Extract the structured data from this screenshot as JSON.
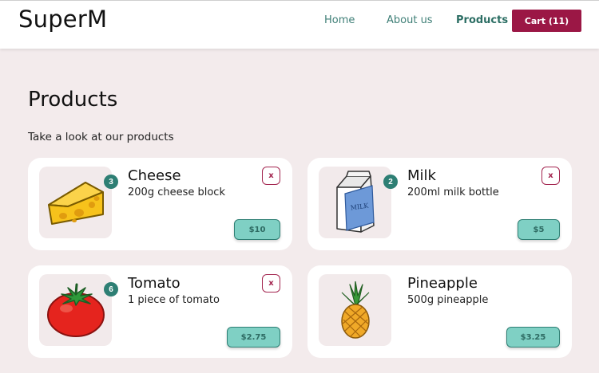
{
  "header": {
    "logo": "SuperM",
    "nav": {
      "home": "Home",
      "about": "About us",
      "products": "Products"
    },
    "cart_label": "Cart (11)"
  },
  "page": {
    "title": "Products",
    "subtitle": "Take a look at our products"
  },
  "products": [
    {
      "name": "Cheese",
      "description": "200g cheese block",
      "quantity": "3",
      "price": "$10",
      "remove_label": "x",
      "icon": "cheese-icon"
    },
    {
      "name": "Milk",
      "description": "200ml milk bottle",
      "quantity": "2",
      "price": "$5",
      "remove_label": "x",
      "icon": "milk-carton-icon",
      "carton_text": "MILK"
    },
    {
      "name": "Tomato",
      "description": "1 piece of tomato",
      "quantity": "6",
      "price": "$2.75",
      "remove_label": "x",
      "icon": "tomato-icon"
    },
    {
      "name": "Pineapple",
      "description": "500g pineapple",
      "price": "$3.25",
      "icon": "pineapple-icon"
    }
  ],
  "colors": {
    "background": "#f3ebec",
    "cart_button": "#9b1745",
    "accent_teal": "#2e7f74",
    "price_button": "#7fd0c4",
    "remove_border": "#a3254f"
  }
}
